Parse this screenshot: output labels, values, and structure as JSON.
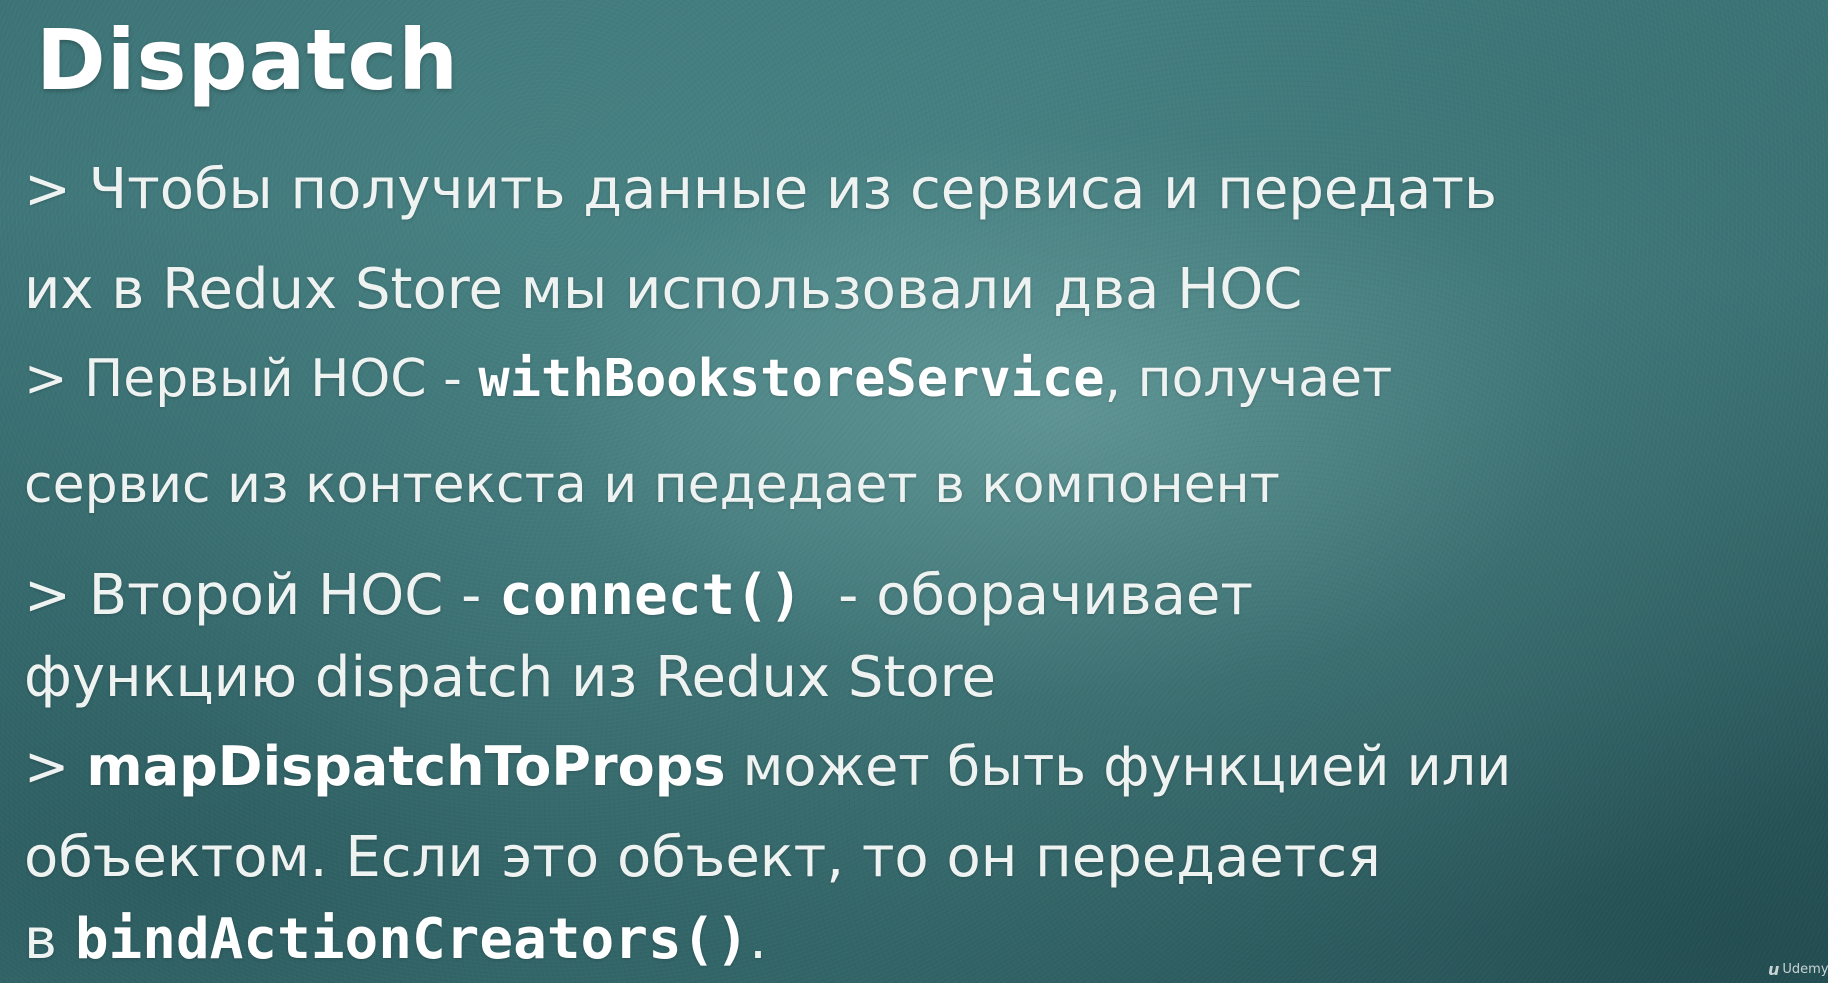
{
  "slide": {
    "title": "Dispatch",
    "lines": [
      {
        "prefix": "> ",
        "text": "Чтобы получить данные из сервиса и передать"
      },
      {
        "text": "их в Redux Store мы использовали два HOC"
      },
      {
        "prefix": "> ",
        "before": "Первый HOC - ",
        "code": "withBookstoreService",
        "after": ", получает"
      },
      {
        "text": "сервис из контекста и педедает в компонент"
      },
      {
        "prefix": "> ",
        "before": "Второй HOC - ",
        "code": "connect()",
        "after": "  - оборачивает"
      },
      {
        "text": "функцию dispatch из Redux Store"
      },
      {
        "prefix": "> ",
        "bold": "mapDispatchToProps",
        "after": " может быть функцией или"
      },
      {
        "text": "объектом. Если это объект, то он передается"
      },
      {
        "before": "в ",
        "code": "bindActionCreators()",
        "after": "."
      }
    ]
  },
  "watermark": {
    "icon": "udemy-logo-icon",
    "text": "Udemy"
  }
}
